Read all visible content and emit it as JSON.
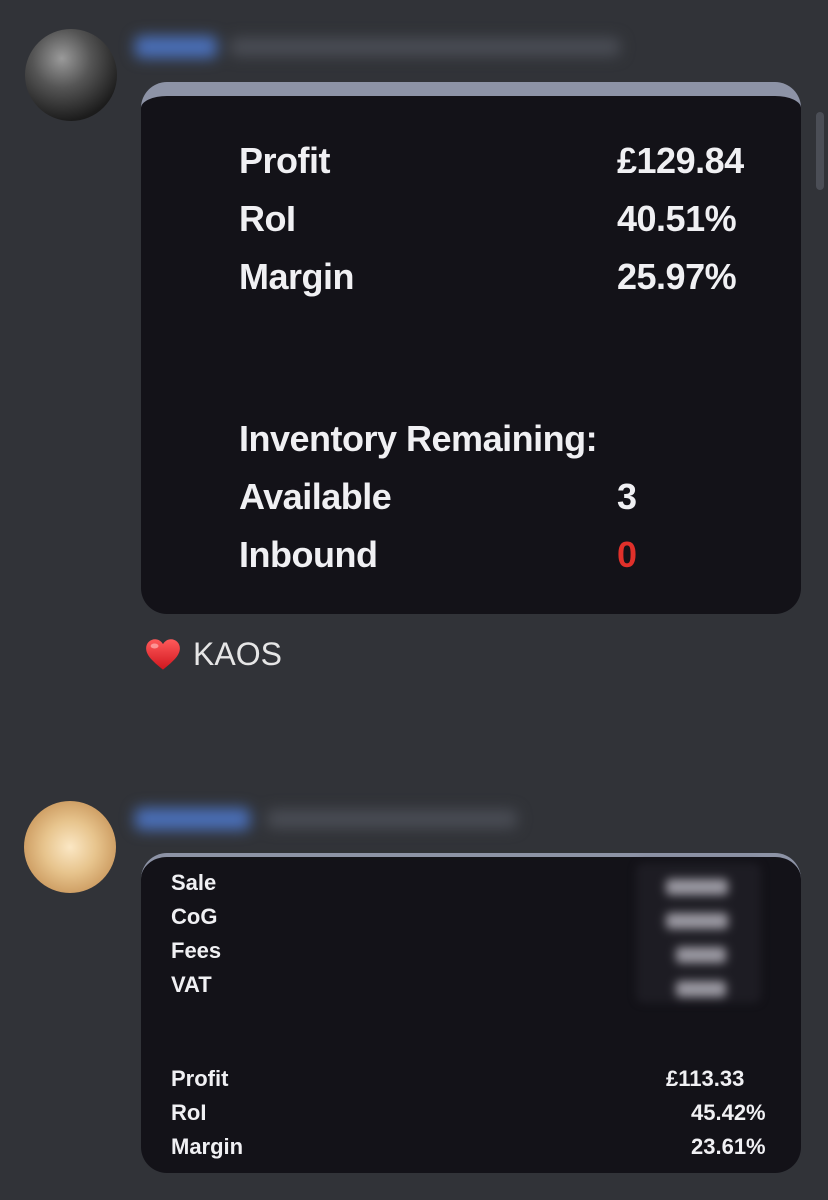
{
  "message_1": {
    "stats": [
      {
        "label": "Profit",
        "value": "£129.84"
      },
      {
        "label": "RoI",
        "value": "40.51%"
      },
      {
        "label": "Margin",
        "value": "25.97%"
      }
    ],
    "inventory_title": "Inventory Remaining:",
    "inventory": [
      {
        "label": "Available",
        "value": "3"
      },
      {
        "label": "Inbound",
        "value": "0"
      }
    ],
    "inbound_color": "#e0302a"
  },
  "reaction": {
    "emoji": "heart-icon",
    "text": "KAOS"
  },
  "message_2": {
    "breakdown_labels": [
      "Sale",
      "CoG",
      "Fees",
      "VAT"
    ],
    "stats": [
      {
        "label": "Profit",
        "value": "£113.33"
      },
      {
        "label": "RoI",
        "value": "45.42%"
      },
      {
        "label": "Margin",
        "value": "23.61%"
      }
    ]
  },
  "colors": {
    "background": "#313338",
    "card": "#131218",
    "card_accent": "#8d93a6",
    "username": "#4a6fb8"
  }
}
